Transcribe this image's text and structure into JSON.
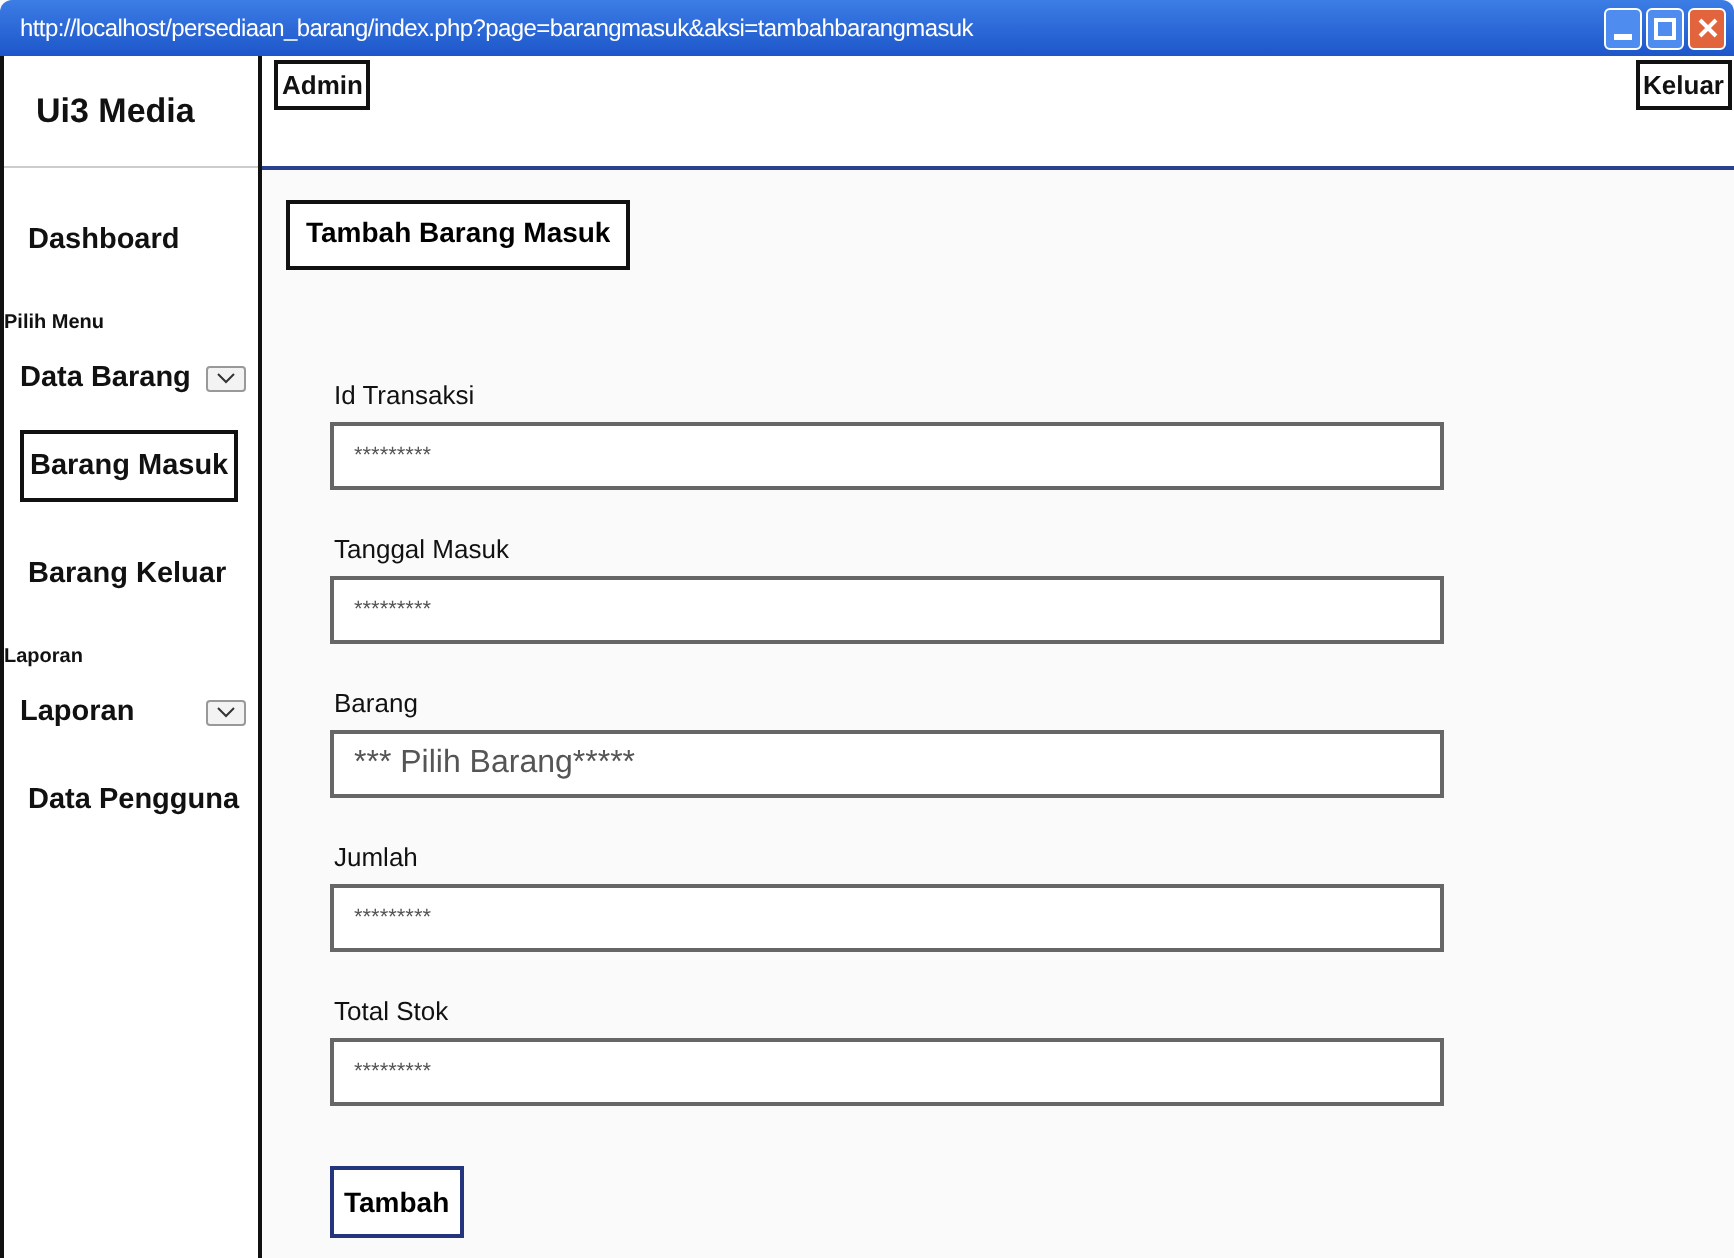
{
  "window": {
    "title": "http://localhost/persediaan_barang/index.php?page=barangmasuk&aksi=tambahbarangmasuk"
  },
  "header": {
    "user": "Admin",
    "logout": "Keluar"
  },
  "sidebar": {
    "brand": "Ui3 Media",
    "items": [
      {
        "kind": "link",
        "label": "Dashboard",
        "selected": false
      },
      {
        "kind": "label",
        "label": "Pilih Menu"
      },
      {
        "kind": "dropdown",
        "label": "Data Barang",
        "selected": false
      },
      {
        "kind": "link",
        "label": "Barang Masuk",
        "selected": true
      },
      {
        "kind": "link",
        "label": "Barang Keluar",
        "selected": false
      },
      {
        "kind": "label",
        "label": "Laporan"
      },
      {
        "kind": "dropdown",
        "label": "Laporan",
        "selected": false
      },
      {
        "kind": "link",
        "label": "Data Pengguna",
        "selected": false
      }
    ]
  },
  "page_title": "Tambah Barang Masuk",
  "form": {
    "fields": [
      {
        "kind": "text",
        "label": "Id Transaksi",
        "placeholder": "*********"
      },
      {
        "kind": "text",
        "label": "Tanggal Masuk",
        "placeholder": "*********"
      },
      {
        "kind": "select",
        "label": "Barang",
        "value": "*** Pilih Barang*****"
      },
      {
        "kind": "text",
        "label": "Jumlah",
        "placeholder": "*********"
      },
      {
        "kind": "text",
        "label": "Total Stok",
        "placeholder": "*********"
      }
    ],
    "submit": "Tambah"
  }
}
